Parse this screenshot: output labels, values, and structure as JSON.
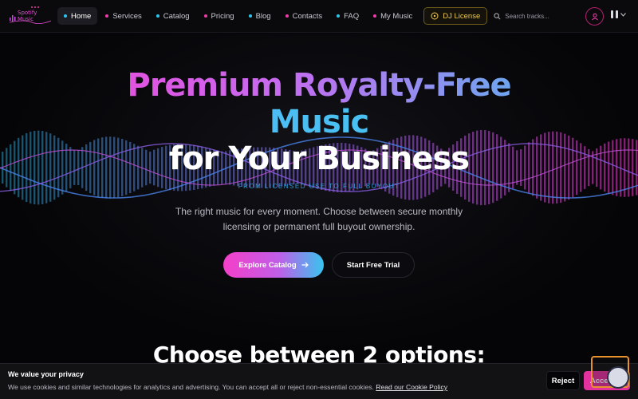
{
  "nav": {
    "logo_text": "Spotify Music",
    "items": [
      {
        "label": "Home",
        "dot": "#2cc6f0",
        "active": true
      },
      {
        "label": "Services",
        "dot": "#f03ca8"
      },
      {
        "label": "Catalog",
        "dot": "#2cc6f0"
      },
      {
        "label": "Pricing",
        "dot": "#f03ca8"
      },
      {
        "label": "Blog",
        "dot": "#2cc6f0"
      },
      {
        "label": "Contacts",
        "dot": "#f03ca8"
      },
      {
        "label": "FAQ",
        "dot": "#2cc6f0"
      },
      {
        "label": "My Music",
        "dot": "#f03ca8"
      }
    ],
    "dj_label": "DJ License",
    "search_placeholder": "Search tracks..."
  },
  "hero": {
    "title_line1": "Premium Royalty-Free",
    "title_line2": "Music",
    "title_line3": "for Your Business",
    "subline": "FROM LICENSED USE TO FULL BUYOUT",
    "description": "The right music for every moment. Choose between secure monthly licensing or permanent full buyout ownership.",
    "primary_cta": "Explore Catalog",
    "secondary_cta": "Start Free Trial"
  },
  "section": {
    "title": "Choose between 2 options:"
  },
  "cookie": {
    "title": "We value your privacy",
    "text": "We use cookies and similar technologies for analytics and advertising. You can accept all or reject non-essential cookies.",
    "link": "Read our Cookie Policy",
    "reject": "Reject",
    "accept": "Accept"
  },
  "colors": {
    "accent_pink": "#f03ca8",
    "accent_cyan": "#2cc6f0",
    "accent_gold": "#f2c94c",
    "background": "#050507"
  }
}
